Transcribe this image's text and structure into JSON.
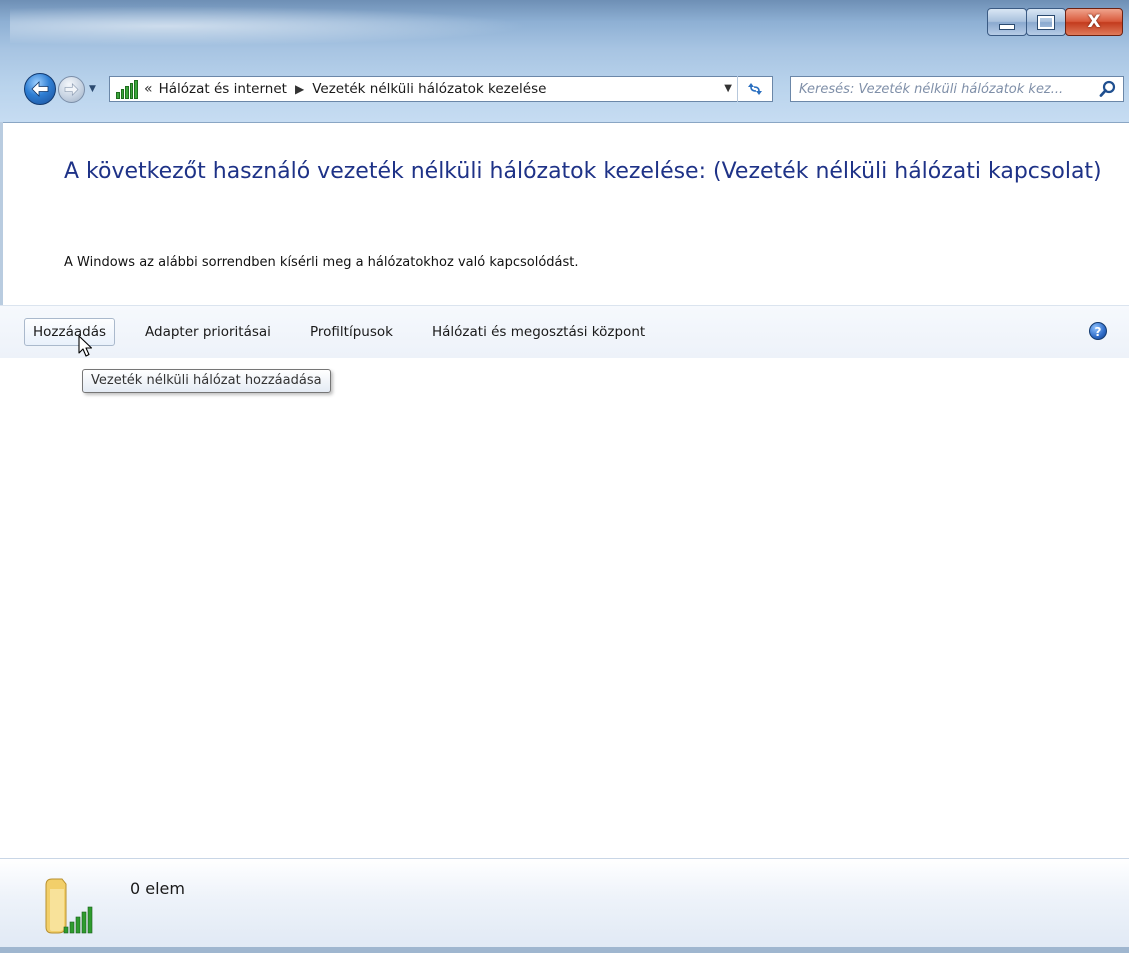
{
  "window": {
    "caption_buttons": {
      "minimize": "minimize",
      "maximize": "maximize",
      "close": "X"
    }
  },
  "navigation": {
    "back_icon": "back-arrow-icon",
    "forward_icon": "forward-arrow-icon",
    "address_icon": "network-signal-icon",
    "breadcrumb_overflow": "«",
    "breadcrumb": [
      "Hálózat és internet",
      "Vezeték nélküli hálózatok kezelése"
    ],
    "refresh_icon": "refresh-icon"
  },
  "search": {
    "placeholder": "Keresés: Vezeték nélküli hálózatok kez..."
  },
  "main": {
    "heading": "A következőt használó vezeték nélküli hálózatok kezelése: (Vezeték nélküli hálózati kapcsolat)",
    "description": "A Windows az alábbi sorrendben kísérli meg a hálózatokhoz való kapcsolódást."
  },
  "toolbar": {
    "items": [
      {
        "label": "Hozzáadás"
      },
      {
        "label": "Adapter prioritásai"
      },
      {
        "label": "Profiltípusok"
      },
      {
        "label": "Hálózati és megosztási központ"
      }
    ],
    "help_label": "?"
  },
  "tooltip": {
    "text": "Vezeték nélküli hálózat hozzáadása"
  },
  "details": {
    "count": "0 elem",
    "icon": "wireless-networks-folder-icon"
  },
  "colors": {
    "heading": "#1e3287",
    "frame": "#a7c4e2",
    "close_button": "#c33b1d"
  }
}
